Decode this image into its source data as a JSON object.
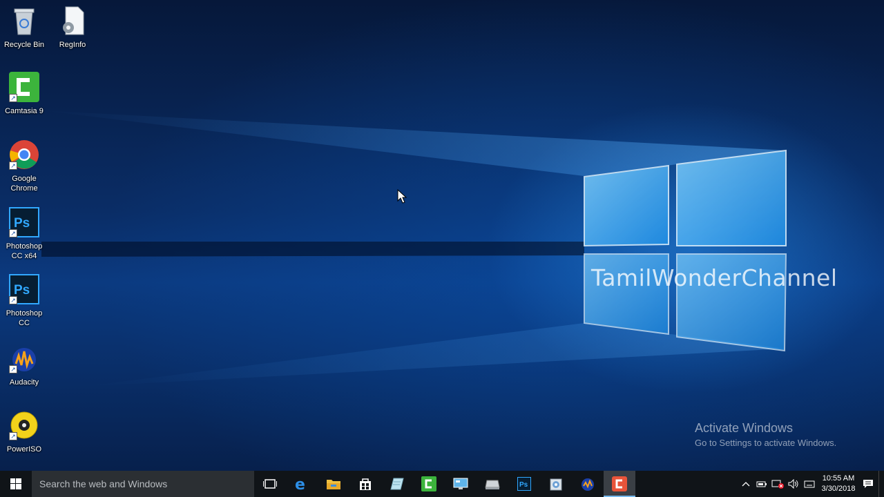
{
  "desktop": {
    "icons": [
      {
        "label": "Recycle Bin",
        "icon": "recycle-bin-icon"
      },
      {
        "label": "RegInfo",
        "icon": "settings-file-icon"
      },
      {
        "label": "Camtasia 9",
        "icon": "camtasia-icon"
      },
      {
        "label": "Google Chrome",
        "icon": "chrome-icon"
      },
      {
        "label": "Photoshop CC x64",
        "icon": "photoshop-icon"
      },
      {
        "label": "Photoshop CC",
        "icon": "photoshop-icon"
      },
      {
        "label": "Audacity",
        "icon": "audacity-icon"
      },
      {
        "label": "PowerISO",
        "icon": "poweriso-icon"
      }
    ],
    "watermark": "TamilWonderChannel",
    "activate": {
      "title": "Activate Windows",
      "subtitle": "Go to Settings to activate Windows."
    }
  },
  "taskbar": {
    "search_placeholder": "Search the web and Windows",
    "apps": [
      {
        "name": "Task View",
        "icon": "task-view-icon"
      },
      {
        "name": "Microsoft Edge",
        "icon": "edge-icon"
      },
      {
        "name": "File Explorer",
        "icon": "folder-icon"
      },
      {
        "name": "Store",
        "icon": "store-icon"
      },
      {
        "name": "Notepad",
        "icon": "notepad-icon"
      },
      {
        "name": "Camtasia",
        "icon": "camtasia-icon"
      },
      {
        "name": "Monitor",
        "icon": "monitor-icon"
      },
      {
        "name": "Drive",
        "icon": "drive-icon"
      },
      {
        "name": "Photoshop",
        "icon": "photoshop-icon"
      },
      {
        "name": "Settings",
        "icon": "settings-tool-icon"
      },
      {
        "name": "Audacity",
        "icon": "audacity-icon"
      },
      {
        "name": "Camtasia Recorder",
        "icon": "recorder-icon"
      }
    ],
    "clock": {
      "time": "10:55 AM",
      "date": "3/30/2018"
    }
  },
  "colors": {
    "taskbar": "#101418",
    "accent": "#76b9ed",
    "wallpaper": "#0b3a80"
  }
}
